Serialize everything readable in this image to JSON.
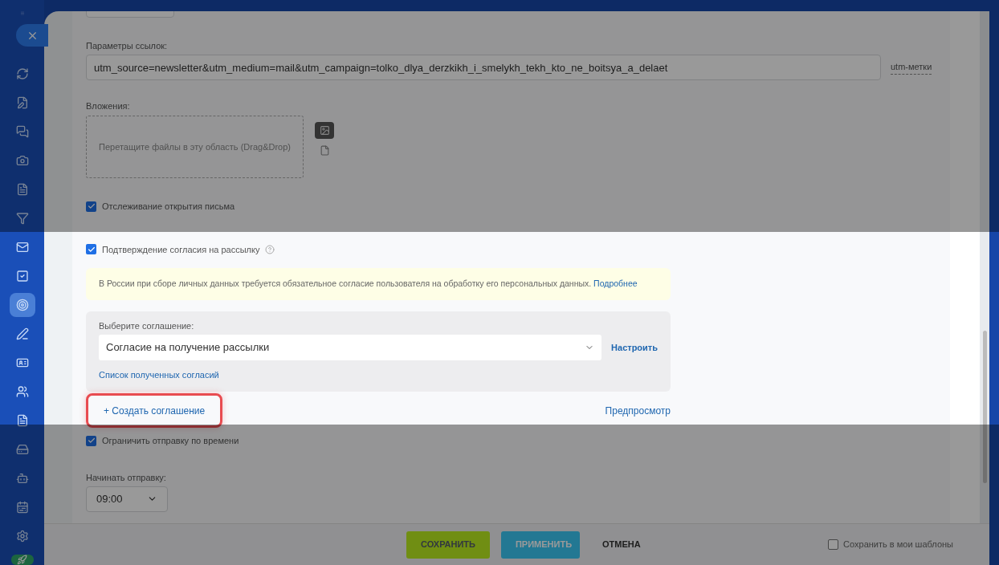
{
  "sidebar": {
    "items": [
      {
        "selected": false
      },
      {
        "selected": false
      },
      {
        "selected": false
      },
      {
        "selected": false
      },
      {
        "selected": false
      },
      {
        "selected": false
      },
      {
        "selected": false
      },
      {
        "selected": false
      },
      {
        "selected": true
      },
      {
        "selected": false
      },
      {
        "selected": false
      },
      {
        "selected": false
      },
      {
        "selected": false
      },
      {
        "selected": false
      },
      {
        "selected": false
      },
      {
        "selected": false
      },
      {
        "selected": false
      }
    ]
  },
  "link_params": {
    "label": "Параметры ссылок:",
    "value": "utm_source=newsletter&utm_medium=mail&utm_campaign=tolko_dlya_derzkikh_i_smelykh_tekh_kto_ne_boitsya_a_delaet",
    "hint_link": "utm-метки"
  },
  "attachments": {
    "label": "Вложения:",
    "dropzone_text": "Перетащите файлы в эту область (Drag&Drop)"
  },
  "options": [
    {
      "label": "Отслеживание открытия письма",
      "checked": true,
      "help": false
    },
    {
      "label": "Подтверждение согласия на рассылку",
      "checked": true,
      "help": true
    }
  ],
  "notice": {
    "text": "В России при сборе личных данных требуется обязательное согласие пользователя на обработку его персональных данных.",
    "link": "Подробнее"
  },
  "agreement": {
    "label": "Выберите соглашение:",
    "value": "Согласие на получение рассылки",
    "configure_link": "Настроить",
    "list_link": "Список полученных согласий"
  },
  "create_link": {
    "label": "+ Создать соглашение",
    "highlighted": true
  },
  "preview_link": "Предпросмотр",
  "time_limit": {
    "label": "Ограничить отправку по времени",
    "checked": true
  },
  "start_time": {
    "label": "Начинать отправку:",
    "value": "09:00"
  },
  "footer": {
    "buttons": [
      {
        "label": "СОХРАНИТЬ",
        "kind": "primary"
      },
      {
        "label": "ПРИМЕНИТЬ",
        "kind": "secondary"
      },
      {
        "label": "ОТМЕНА",
        "kind": "link"
      }
    ],
    "template_checkbox": {
      "label": "Сохранить в мои шаблоны",
      "checked": false
    }
  }
}
